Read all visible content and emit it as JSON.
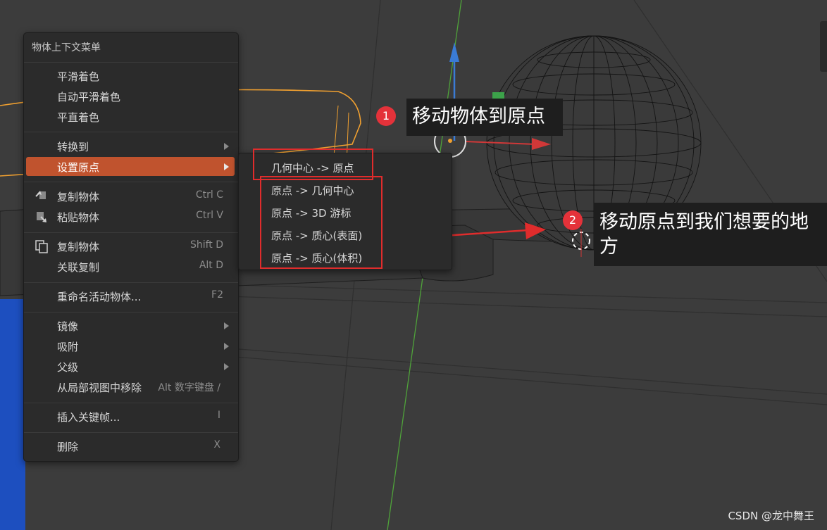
{
  "context_menu": {
    "title": "物体上下文菜单",
    "items": [
      {
        "label": "平滑着色",
        "shortcut": ""
      },
      {
        "label": "自动平滑着色",
        "shortcut": ""
      },
      {
        "label": "平直着色",
        "shortcut": ""
      },
      {
        "label": "转换到",
        "shortcut": "",
        "submenu": true
      },
      {
        "label": "设置原点",
        "shortcut": "",
        "submenu": true,
        "highlighted": true
      },
      {
        "label": "复制物体",
        "shortcut": "Ctrl C",
        "icon": "copy-icon"
      },
      {
        "label": "粘贴物体",
        "shortcut": "Ctrl V",
        "icon": "paste-icon"
      },
      {
        "label": "复制物体",
        "shortcut": "Shift D",
        "icon": "duplicate-icon"
      },
      {
        "label": "关联复制",
        "shortcut": "Alt D"
      },
      {
        "label": "重命名活动物体...",
        "shortcut": "F2"
      },
      {
        "label": "镜像",
        "shortcut": "",
        "submenu": true
      },
      {
        "label": "吸附",
        "shortcut": "",
        "submenu": true
      },
      {
        "label": "父级",
        "shortcut": "",
        "submenu": true
      },
      {
        "label": "从局部视图中移除",
        "shortcut": "Alt 数字键盘 /"
      },
      {
        "label": "插入关键帧...",
        "shortcut": "I"
      },
      {
        "label": "删除",
        "shortcut": "X"
      }
    ]
  },
  "origin_submenu": {
    "items": [
      "几何中心 -> 原点",
      "原点 -> 几何中心",
      "原点 -> 3D 游标",
      "原点 -> 质心(表面)",
      "原点 -> 质心(体积)"
    ]
  },
  "annotations": {
    "step1_number": "1",
    "step1_text": "移动物体到原点",
    "step2_number": "2",
    "step2_text_line1": "移动原点到我们想要的地",
    "step2_text_line2": "方"
  },
  "watermark": "CSDN @龙中舞王",
  "colors": {
    "highlight": "#c0532e",
    "annotation_red": "#e02c2c",
    "viewport_bg": "#3b3b3b",
    "selection_orange": "#f0a030"
  }
}
